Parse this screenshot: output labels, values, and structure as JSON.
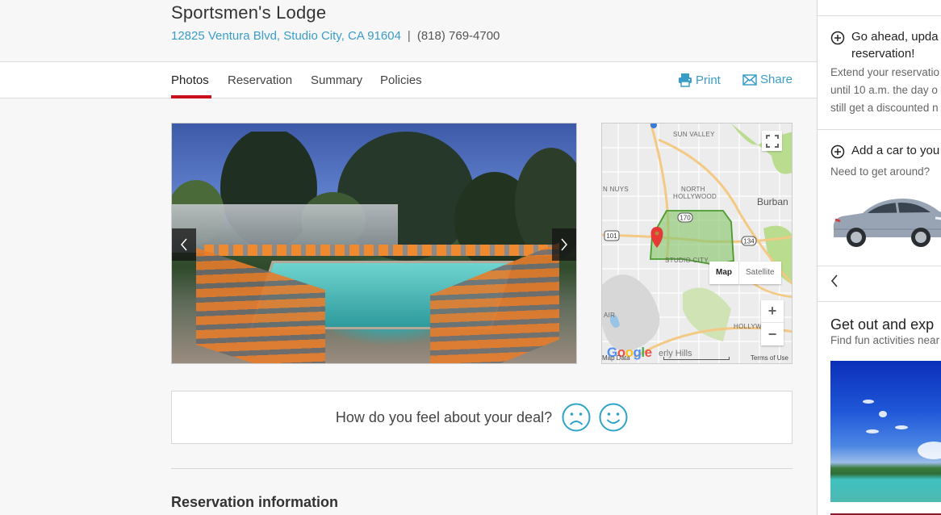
{
  "hotel": {
    "name": "Sportsmen's Lodge",
    "address": "12825 Ventura Blvd, Studio City, CA 91604",
    "separator": "|",
    "phone": "(818) 769-4700"
  },
  "tabs": [
    {
      "label": "Photos",
      "active": true
    },
    {
      "label": "Reservation",
      "active": false
    },
    {
      "label": "Summary",
      "active": false
    },
    {
      "label": "Policies",
      "active": false
    }
  ],
  "actions": {
    "print_label": "Print",
    "share_label": "Share"
  },
  "gallery": {
    "prev_icon": "chevron-left",
    "next_icon": "chevron-right"
  },
  "map": {
    "labels": {
      "sun_valley": "SUN VALLEY",
      "north_hollywood_1": "NORTH",
      "north_hollywood_2": "HOLLYWOOD",
      "van_nuys": "N NUYS",
      "burbank": "Burban",
      "studio_city": "STUDIO CITY",
      "air": "AIR",
      "hollywood": "HOLLYW",
      "beverly_hills": "erly Hills"
    },
    "shields": {
      "hwy_101": "101",
      "hwy_170": "170",
      "hwy_134": "134"
    },
    "maptype_map": "Map",
    "maptype_satellite": "Satellite",
    "zoom_in": "+",
    "zoom_out": "−",
    "map_data": "Map Data",
    "terms": "Terms of Use",
    "google": "Google",
    "area_color": "#8bc870",
    "pin_color": "#e53935"
  },
  "feedback": {
    "question": "How do you feel about your deal?",
    "negative_icon": "sad-face",
    "positive_icon": "happy-face",
    "icon_color": "#2ea3c8"
  },
  "reservation_info": {
    "title": "Reservation information"
  },
  "sidebar": {
    "upgrade": {
      "title_line1": "Go ahead, upda",
      "title_line2": "reservation!",
      "body": [
        "Extend your reservatio",
        "until 10 a.m. the day o",
        "still get a discounted n"
      ]
    },
    "car": {
      "title": "Add a car to you",
      "body": "Need to get around?"
    },
    "explore": {
      "title": "Get out and exp",
      "body": "Find fun activities near"
    }
  },
  "colors": {
    "link": "#3a9dc8",
    "tab_active_underline": "#c8101e",
    "background": "#f7f7f7"
  }
}
